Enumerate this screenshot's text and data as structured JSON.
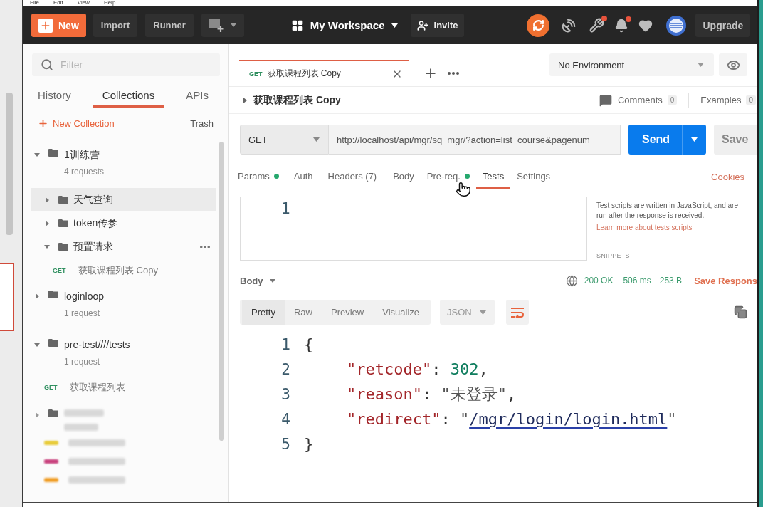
{
  "menu_bar": [
    "File",
    "Edit",
    "View",
    "Help"
  ],
  "header": {
    "new_button": "New",
    "import_button": "Import",
    "runner_button": "Runner",
    "workspace": "My Workspace",
    "invite_button": "Invite",
    "icons": [
      {
        "kind": "sync",
        "badge": false
      },
      {
        "kind": "satellite",
        "badge": false
      },
      {
        "kind": "wrench",
        "badge": true
      },
      {
        "kind": "bell",
        "badge": true
      },
      {
        "kind": "heart",
        "badge": false
      },
      {
        "kind": "avatar",
        "badge": false
      }
    ],
    "upgrade_button": "Upgrade"
  },
  "sidebar": {
    "filter": {
      "placeholder": "Filter"
    },
    "tabs": [
      {
        "label": "History",
        "selected": false
      },
      {
        "label": "Collections",
        "selected": true
      },
      {
        "label": "APIs",
        "selected": false
      }
    ],
    "new_collection": "New Collection",
    "trash": "Trash",
    "collections": [
      {
        "kind": "collection",
        "name": "1训练营",
        "count": "4 requests",
        "expanded": true,
        "children": [
          {
            "kind": "folder",
            "name": "天气查询",
            "expanded": false,
            "selected": true,
            "actions_visible": false
          },
          {
            "kind": "folder",
            "name": "token传参",
            "expanded": false,
            "selected": false,
            "actions_visible": false
          },
          {
            "kind": "folder",
            "name": "预置请求",
            "expanded": true,
            "selected": false,
            "actions_visible": true,
            "children": [
              {
                "kind": "request",
                "method": "GET",
                "name": "获取课程列表 Copy",
                "selected": false
              }
            ]
          }
        ]
      },
      {
        "kind": "collection",
        "name": "loginloop",
        "count": "1 request",
        "expanded": false
      },
      {
        "kind": "collection",
        "name": "pre-test////tests",
        "count": "1 request",
        "expanded": true,
        "children": [
          {
            "kind": "request",
            "method": "GET",
            "name": "获取课程列表",
            "selected": false
          }
        ]
      },
      {
        "kind": "obscured_collection"
      },
      {
        "kind": "obscured_request",
        "color": "#e8cc3c"
      },
      {
        "kind": "obscured_request",
        "color": "#c8407c"
      },
      {
        "kind": "obscured_request",
        "color": "#f0a02c"
      }
    ]
  },
  "open_tabs": [
    {
      "method": "GET",
      "name": "获取课程列表 Copy",
      "selected": true
    }
  ],
  "environment": "No Environment",
  "request": {
    "name": "获取课程列表 Copy",
    "comments": {
      "label": "Comments",
      "count": "0"
    },
    "examples": {
      "label": "Examples",
      "count": "0"
    },
    "method": "GET",
    "url": "http://localhost/api/mgr/sq_mgr/?action=list_course&pagenum",
    "send_button": "Send",
    "save_button": "Save"
  },
  "request_tabs": [
    {
      "label": "Params",
      "dot": true,
      "selected": false
    },
    {
      "label": "Auth",
      "dot": false,
      "selected": false
    },
    {
      "label": "Headers (7)",
      "dot": false,
      "selected": false
    },
    {
      "label": "Body",
      "dot": false,
      "selected": false
    },
    {
      "label": "Pre-req.",
      "dot": true,
      "selected": false
    },
    {
      "label": "Tests",
      "dot": false,
      "selected": true
    },
    {
      "label": "Settings",
      "dot": false,
      "selected": false
    }
  ],
  "cookies_link": "Cookies",
  "tests": {
    "line_numbers": [
      "1"
    ],
    "help_text": "Test scripts are written in JavaScript, and are run after the response is received.",
    "help_link": "Learn more about tests scripts",
    "snippets_heading": "SNIPPETS"
  },
  "response": {
    "section": "Body",
    "status": "200 OK",
    "time": "506 ms",
    "size": "253 B",
    "save_link": "Save Respons",
    "view_tabs": [
      {
        "label": "Pretty",
        "selected": true
      },
      {
        "label": "Raw",
        "selected": false
      },
      {
        "label": "Preview",
        "selected": false
      },
      {
        "label": "Visualize",
        "selected": false
      }
    ],
    "format": "JSON",
    "wrap": true,
    "lines": [
      {
        "number": "1",
        "indent": false,
        "tokens": [
          {
            "kind": "punct",
            "text": "{"
          }
        ]
      },
      {
        "number": "2",
        "indent": true,
        "tokens": [
          {
            "kind": "key",
            "text": "\"retcode\""
          },
          {
            "kind": "punct",
            "text": ": "
          },
          {
            "kind": "number",
            "text": "302"
          },
          {
            "kind": "punct",
            "text": ","
          }
        ]
      },
      {
        "number": "3",
        "indent": true,
        "tokens": [
          {
            "kind": "key",
            "text": "\"reason\""
          },
          {
            "kind": "punct",
            "text": ": "
          },
          {
            "kind": "string",
            "text": "\"未登录\""
          },
          {
            "kind": "punct",
            "text": ","
          }
        ]
      },
      {
        "number": "4",
        "indent": true,
        "tokens": [
          {
            "kind": "key",
            "text": "\"redirect\""
          },
          {
            "kind": "punct",
            "text": ": "
          },
          {
            "kind": "string",
            "text": "\""
          },
          {
            "kind": "link",
            "text": "/mgr/login/login.html"
          },
          {
            "kind": "string",
            "text": "\""
          }
        ]
      },
      {
        "number": "5",
        "indent": false,
        "tokens": [
          {
            "kind": "punct",
            "text": "}"
          }
        ]
      }
    ]
  }
}
